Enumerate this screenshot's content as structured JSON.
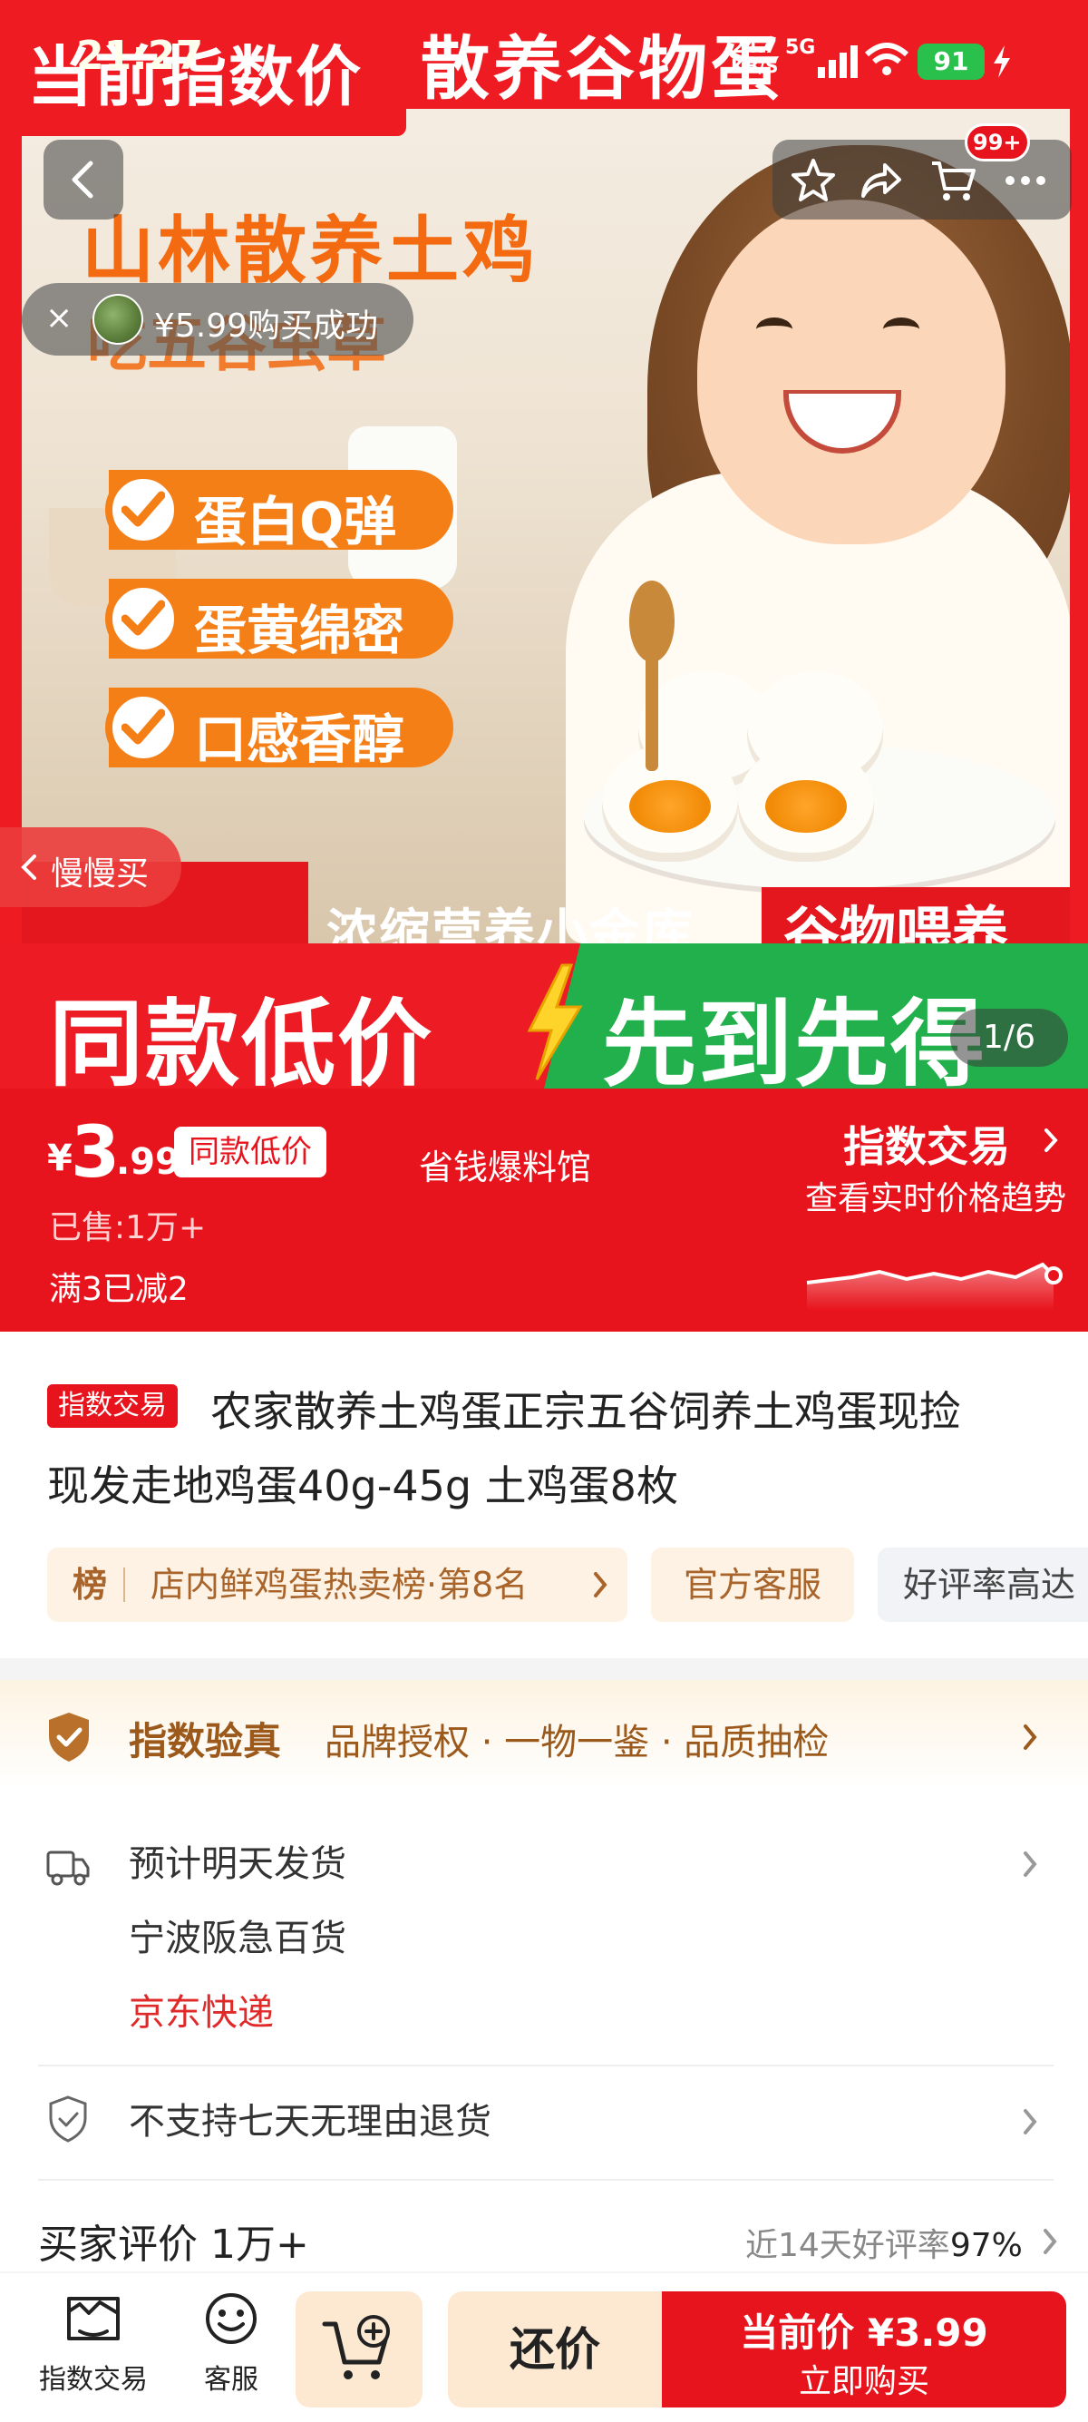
{
  "status_bar": {
    "time": "21:27",
    "speed_top": "24.7",
    "speed_unit": "KB/S",
    "network": "5G",
    "battery": "91"
  },
  "hero": {
    "top_badge": "当前指数价",
    "top_title": "散养谷物蛋",
    "headline": "山林散养土鸡",
    "subheadline": "吃五谷虫草",
    "features": [
      "蛋白Q弹",
      "蛋黄绵密",
      "口感香醇"
    ],
    "bottom_left_text": "浓缩营养小金库",
    "bottom_right_text": "谷物喂养",
    "promo_left": "同款低价",
    "promo_right": "先到先得",
    "page_indicator": "1/6",
    "cart_badge": "99+",
    "toast": "¥5.99购买成功",
    "toast_close": "×",
    "slow_buy": "慢慢买"
  },
  "price": {
    "yen": "¥",
    "integer": "3",
    "decimal": ".99",
    "badge": "同款低价",
    "shop": "省钱爆料馆",
    "sold": "已售:1万+",
    "discount": "满3已减2",
    "index_trade": "指数交易",
    "trend": "查看实时价格趋势"
  },
  "title_section": {
    "tag": "指数交易",
    "line1": "农家散养土鸡蛋正宗五谷饲养土鸡蛋现捡",
    "line2": "现发走地鸡蛋40g-45g 土鸡蛋8枚",
    "rank_head": "榜",
    "rank_text": "店内鲜鸡蛋热卖榜·第8名",
    "service_chip": "官方客服",
    "rating_chip": "好评率高达"
  },
  "verify": {
    "title": "指数验真",
    "desc": "品牌授权 · 一物一鉴 · 品质抽检"
  },
  "shipping": {
    "line1": "预计明天发货",
    "line2": "宁波阪急百货",
    "line3": "京东快递",
    "return_policy": "不支持七天无理由退货"
  },
  "reviews": {
    "title": "买家评价 1万+",
    "rate_label": "近14天好评率",
    "rate_value": "97%"
  },
  "bottom_bar": {
    "tab_index": "指数交易",
    "tab_service": "客服",
    "bargain": "还价",
    "buy_price": "当前价 ¥3.99",
    "buy_label": "立即购买"
  },
  "colors": {
    "brand_red": "#e8141d",
    "promo_green": "#21b04b",
    "accent_orange": "#f57f17",
    "gold_text": "#9b5a1c"
  }
}
